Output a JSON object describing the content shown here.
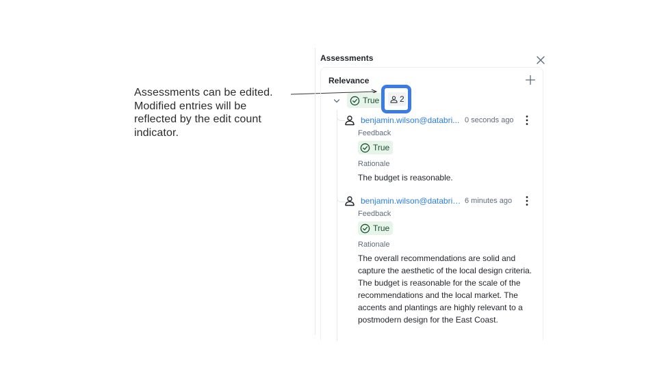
{
  "annotation": {
    "text": "Assessments can be edited. Modified entries will be reflected by the edit count indicator."
  },
  "panel": {
    "title": "Assessments"
  },
  "assessment": {
    "name": "Relevance",
    "summary_value": "True",
    "edit_count": "2",
    "entries": [
      {
        "author": "benjamin.wilson@databri...",
        "timestamp": "0 seconds ago",
        "feedback_label": "Feedback",
        "feedback_value": "True",
        "rationale_label": "Rationale",
        "rationale": "The budget is reasonable."
      },
      {
        "author": "benjamin.wilson@databric...",
        "timestamp": "6 minutes ago",
        "feedback_label": "Feedback",
        "feedback_value": "True",
        "rationale_label": "Rationale",
        "rationale": "The overall recommendations are solid and capture the aesthetic of the local design criteria. The budget is reasonable for the scale of the recommendations and the local market. The accents and plantings are highly relevant to a postmodern design for the East Coast."
      }
    ]
  },
  "colors": {
    "link": "#2a7de1",
    "success_bg": "#e6f4ea",
    "success_fg": "#1a4d2e",
    "highlight": "#3b7be8"
  },
  "icons": [
    "close-icon",
    "add-icon",
    "chevron-down-icon",
    "check-circle-icon",
    "user-icon",
    "kebab-icon"
  ]
}
